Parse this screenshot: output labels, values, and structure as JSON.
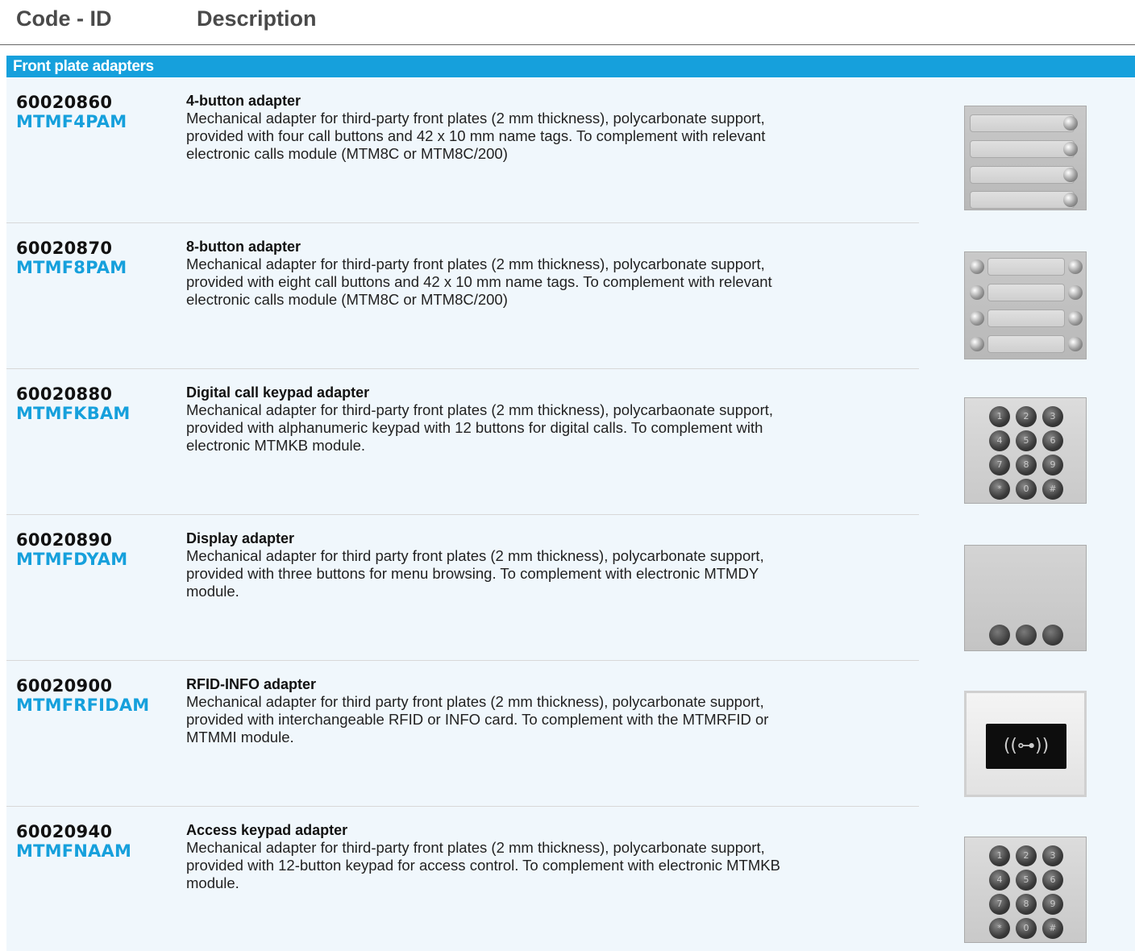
{
  "header": {
    "code_label": "Code - ID",
    "description_label": "Description"
  },
  "section": {
    "title": "Front plate adapters"
  },
  "products": [
    {
      "code": "60020860",
      "model": "MTMF4PAM",
      "title": "4-button adapter",
      "description": "Mechanical adapter for third-party front plates (2 mm thickness), polycarbonate support, provided with four call buttons and 42 x 10 mm name tags. To complement with relevant electronic calls module (MTM8C or MTM8C/200)",
      "image": "4-button-plate-image"
    },
    {
      "code": "60020870",
      "model": "MTMF8PAM",
      "title": "8-button adapter",
      "description": "Mechanical adapter for third-party front plates (2 mm thickness), polycarbonate support, provided with eight call buttons and 42 x 10 mm name tags. To complement with relevant electronic calls module (MTM8C or MTM8C/200)",
      "image": "8-button-plate-image"
    },
    {
      "code": "60020880",
      "model": "MTMFKBAM",
      "title": "Digital call keypad adapter",
      "description": "Mechanical adapter for third-party front plates (2 mm thickness), polycarbaonate support, provided with alphanumeric keypad with 12 buttons for digital calls. To complement with electronic MTMKB module.",
      "image": "keypad-image"
    },
    {
      "code": "60020890",
      "model": "MTMFDYAM",
      "title": "Display adapter",
      "description": "Mechanical adapter for third party front plates (2 mm thickness), polycarbonate support, provided with three buttons for menu browsing. To complement with electronic MTMDY module.",
      "image": "display-plate-image"
    },
    {
      "code": "60020900",
      "model": "MTMFRFIDAM",
      "title": "RFID-INFO adapter",
      "description": "Mechanical adapter for third party front plates (2 mm thickness), polycarbonate support, provided with interchangeable RFID or INFO card. To complement with the MTMRFID or MTMMI module.",
      "image": "rfid-plate-image"
    },
    {
      "code": "60020940",
      "model": "MTMFNAAM",
      "title": "Access keypad adapter",
      "description": "Mechanical adapter for third-party front plates (2 mm thickness), polycarbonate support, provided with 12-button keypad for access control. To complement with electronic MTMKB module.",
      "image": "access-keypad-image"
    }
  ]
}
